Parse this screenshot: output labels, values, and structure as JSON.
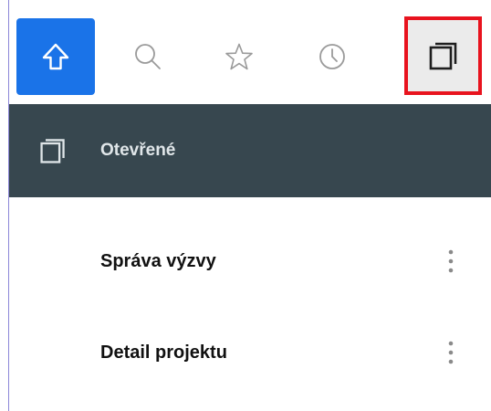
{
  "toolbar": {
    "buttons": [
      {
        "icon": "home-icon",
        "active": true
      },
      {
        "icon": "search-icon",
        "active": false
      },
      {
        "icon": "star-icon",
        "active": false
      },
      {
        "icon": "clock-icon",
        "active": false
      },
      {
        "icon": "open-windows-icon",
        "active": false,
        "highlighted": true
      }
    ]
  },
  "section": {
    "title": "Otevřené",
    "icon": "open-windows-icon"
  },
  "items": [
    {
      "label": "Správa výzvy",
      "menu_icon": "more-vertical-icon"
    },
    {
      "label": "Detail projektu",
      "menu_icon": "more-vertical-icon"
    }
  ],
  "colors": {
    "accent": "#1a73e8",
    "header_bg": "#37474f",
    "highlight_border": "#e8131e"
  }
}
